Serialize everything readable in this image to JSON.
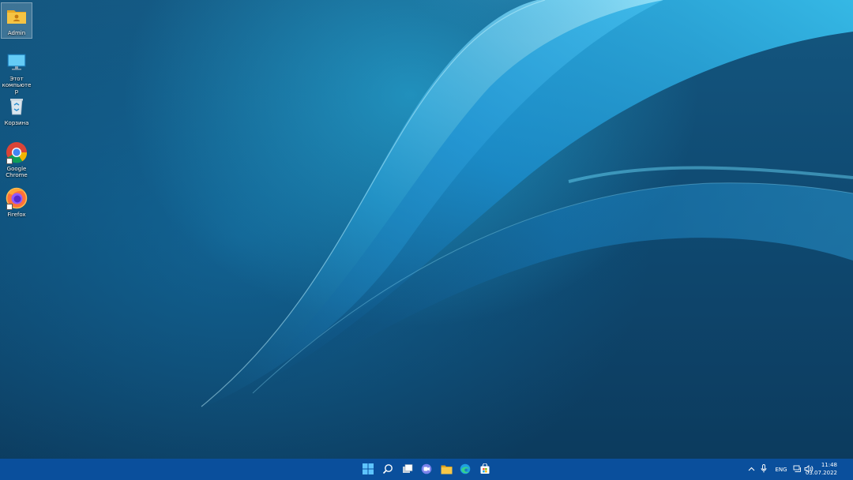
{
  "desktop": {
    "icons": [
      {
        "label": "Admin",
        "icon": "user-folder-icon"
      },
      {
        "label": "Этот компьютер",
        "icon": "this-pc-icon"
      },
      {
        "label": "Корзина",
        "icon": "recycle-bin-icon"
      },
      {
        "label": "Google Chrome",
        "icon": "chrome-icon"
      },
      {
        "label": "Firefox",
        "icon": "firefox-icon"
      }
    ]
  },
  "taskbar": {
    "pinned": [
      {
        "name": "start",
        "icon": "windows-logo-icon"
      },
      {
        "name": "search",
        "icon": "search-icon"
      },
      {
        "name": "task-view",
        "icon": "task-view-icon"
      },
      {
        "name": "chat",
        "icon": "teams-chat-icon"
      },
      {
        "name": "file-explorer",
        "icon": "folder-icon"
      },
      {
        "name": "edge",
        "icon": "edge-icon"
      },
      {
        "name": "store",
        "icon": "store-icon"
      }
    ],
    "tray": {
      "language": "ENG",
      "time": "11:48",
      "date": "03.07.2022",
      "icons": [
        "chevron-up-icon",
        "microphone-icon",
        "network-icon",
        "volume-icon"
      ]
    }
  },
  "colors": {
    "taskbar": "#0a4f9c",
    "accent_light": "#3fd0f5",
    "desktop_base": "#0f4a72"
  }
}
